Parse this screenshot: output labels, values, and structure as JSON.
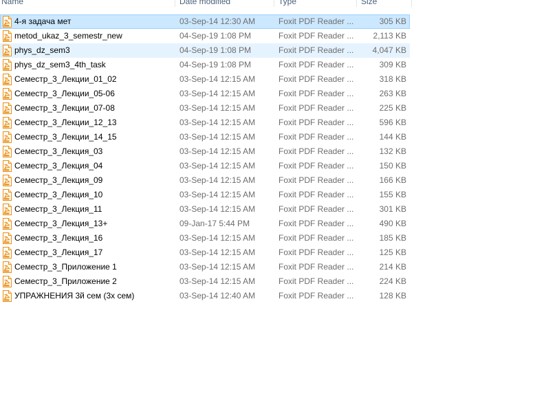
{
  "columns": {
    "name": "Name",
    "date": "Date modified",
    "type": "Type",
    "size": "Size"
  },
  "files": [
    {
      "name": "4-я задача мет",
      "date": "03-Sep-14 12:30 AM",
      "type": "Foxit PDF Reader ...",
      "size": "305 KB",
      "state": "selected"
    },
    {
      "name": "metod_ukaz_3_semestr_new",
      "date": "04-Sep-19 1:08 PM",
      "type": "Foxit PDF Reader ...",
      "size": "2,113 KB",
      "state": ""
    },
    {
      "name": "phys_dz_sem3",
      "date": "04-Sep-19 1:08 PM",
      "type": "Foxit PDF Reader ...",
      "size": "4,047 KB",
      "state": "hover"
    },
    {
      "name": "phys_dz_sem3_4th_task",
      "date": "04-Sep-19 1:08 PM",
      "type": "Foxit PDF Reader ...",
      "size": "309 KB",
      "state": ""
    },
    {
      "name": "Семестр_3_Лекции_01_02",
      "date": "03-Sep-14 12:15 AM",
      "type": "Foxit PDF Reader ...",
      "size": "318 KB",
      "state": ""
    },
    {
      "name": "Семестр_3_Лекции_05-06",
      "date": "03-Sep-14 12:15 AM",
      "type": "Foxit PDF Reader ...",
      "size": "263 KB",
      "state": ""
    },
    {
      "name": "Семестр_3_Лекции_07-08",
      "date": "03-Sep-14 12:15 AM",
      "type": "Foxit PDF Reader ...",
      "size": "225 KB",
      "state": ""
    },
    {
      "name": "Семестр_3_Лекции_12_13",
      "date": "03-Sep-14 12:15 AM",
      "type": "Foxit PDF Reader ...",
      "size": "596 KB",
      "state": ""
    },
    {
      "name": "Семестр_3_Лекции_14_15",
      "date": "03-Sep-14 12:15 AM",
      "type": "Foxit PDF Reader ...",
      "size": "144 KB",
      "state": ""
    },
    {
      "name": "Семестр_3_Лекция_03",
      "date": "03-Sep-14 12:15 AM",
      "type": "Foxit PDF Reader ...",
      "size": "132 KB",
      "state": ""
    },
    {
      "name": "Семестр_3_Лекция_04",
      "date": "03-Sep-14 12:15 AM",
      "type": "Foxit PDF Reader ...",
      "size": "150 KB",
      "state": ""
    },
    {
      "name": "Семестр_3_Лекция_09",
      "date": "03-Sep-14 12:15 AM",
      "type": "Foxit PDF Reader ...",
      "size": "166 KB",
      "state": ""
    },
    {
      "name": "Семестр_3_Лекция_10",
      "date": "03-Sep-14 12:15 AM",
      "type": "Foxit PDF Reader ...",
      "size": "155 KB",
      "state": ""
    },
    {
      "name": "Семестр_3_Лекция_11",
      "date": "03-Sep-14 12:15 AM",
      "type": "Foxit PDF Reader ...",
      "size": "301 KB",
      "state": ""
    },
    {
      "name": "Семестр_3_Лекция_13+",
      "date": "09-Jan-17 5:44 PM",
      "type": "Foxit PDF Reader ...",
      "size": "490 KB",
      "state": ""
    },
    {
      "name": "Семестр_3_Лекция_16",
      "date": "03-Sep-14 12:15 AM",
      "type": "Foxit PDF Reader ...",
      "size": "185 KB",
      "state": ""
    },
    {
      "name": "Семестр_3_Лекция_17",
      "date": "03-Sep-14 12:15 AM",
      "type": "Foxit PDF Reader ...",
      "size": "125 KB",
      "state": ""
    },
    {
      "name": "Семестр_3_Приложение 1",
      "date": "03-Sep-14 12:15 AM",
      "type": "Foxit PDF Reader ...",
      "size": "214 KB",
      "state": ""
    },
    {
      "name": "Семестр_3_Приложение 2",
      "date": "03-Sep-14 12:15 AM",
      "type": "Foxit PDF Reader ...",
      "size": "224 KB",
      "state": ""
    },
    {
      "name": "УПРАЖНЕНИЯ 3й сем (3х сем)",
      "date": "03-Sep-14 12:40 AM",
      "type": "Foxit PDF Reader ...",
      "size": "128 KB",
      "state": ""
    }
  ],
  "icon": "pdf-file-icon",
  "colors": {
    "selected_bg": "#cce8ff",
    "selected_border": "#99d1ff",
    "hover_bg": "#e5f3ff",
    "header_text": "#4c607a",
    "icon_orange": "#e8901a"
  }
}
